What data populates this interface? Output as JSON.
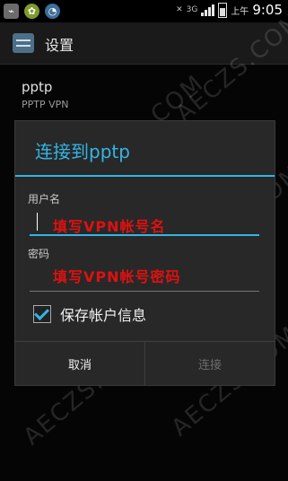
{
  "status_bar": {
    "network_label": "3G",
    "ampm": "上午",
    "time": "9:05"
  },
  "action_bar": {
    "title": "设置"
  },
  "vpn_item": {
    "name": "pptp",
    "type": "PPTP VPN"
  },
  "dialog": {
    "title": "连接到pptp",
    "username_label": "用户名",
    "username_hint": "填写VPN帐号名",
    "password_label": "密码",
    "password_hint": "填写VPN帐号密码",
    "save_label": "保存帐户信息",
    "save_checked": true,
    "cancel_label": "取消",
    "connect_label": "连接"
  },
  "watermark": "AECZS.COM",
  "colors": {
    "accent": "#33b5e5",
    "annotation": "#e01010",
    "background": "#050505",
    "dialog": "#282828"
  }
}
